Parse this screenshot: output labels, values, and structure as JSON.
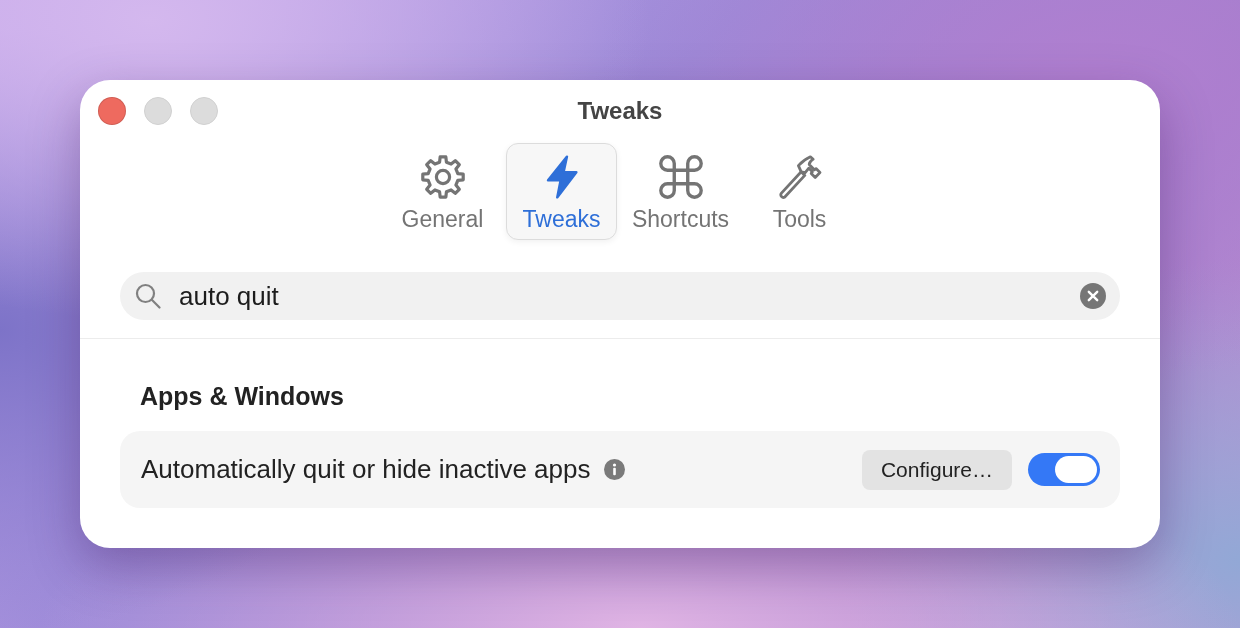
{
  "window": {
    "title": "Tweaks",
    "buttons": [
      {
        "kind": "close",
        "disabled": false
      },
      {
        "kind": "minimize",
        "disabled": true
      },
      {
        "kind": "zoom",
        "disabled": true
      }
    ]
  },
  "tabs": [
    {
      "label": "General",
      "kind": "gear",
      "selected": false
    },
    {
      "label": "Tweaks",
      "kind": "bolt",
      "selected": true
    },
    {
      "label": "Shortcuts",
      "kind": "command",
      "selected": false
    },
    {
      "label": "Tools",
      "kind": "hammer",
      "selected": false
    }
  ],
  "search": {
    "value": "auto quit"
  },
  "sections": [
    {
      "title": "Apps & Windows",
      "rows": [
        {
          "label": "Automatically quit or hide inactive apps",
          "info": true,
          "button": "Configure…",
          "on": true
        }
      ]
    }
  ]
}
